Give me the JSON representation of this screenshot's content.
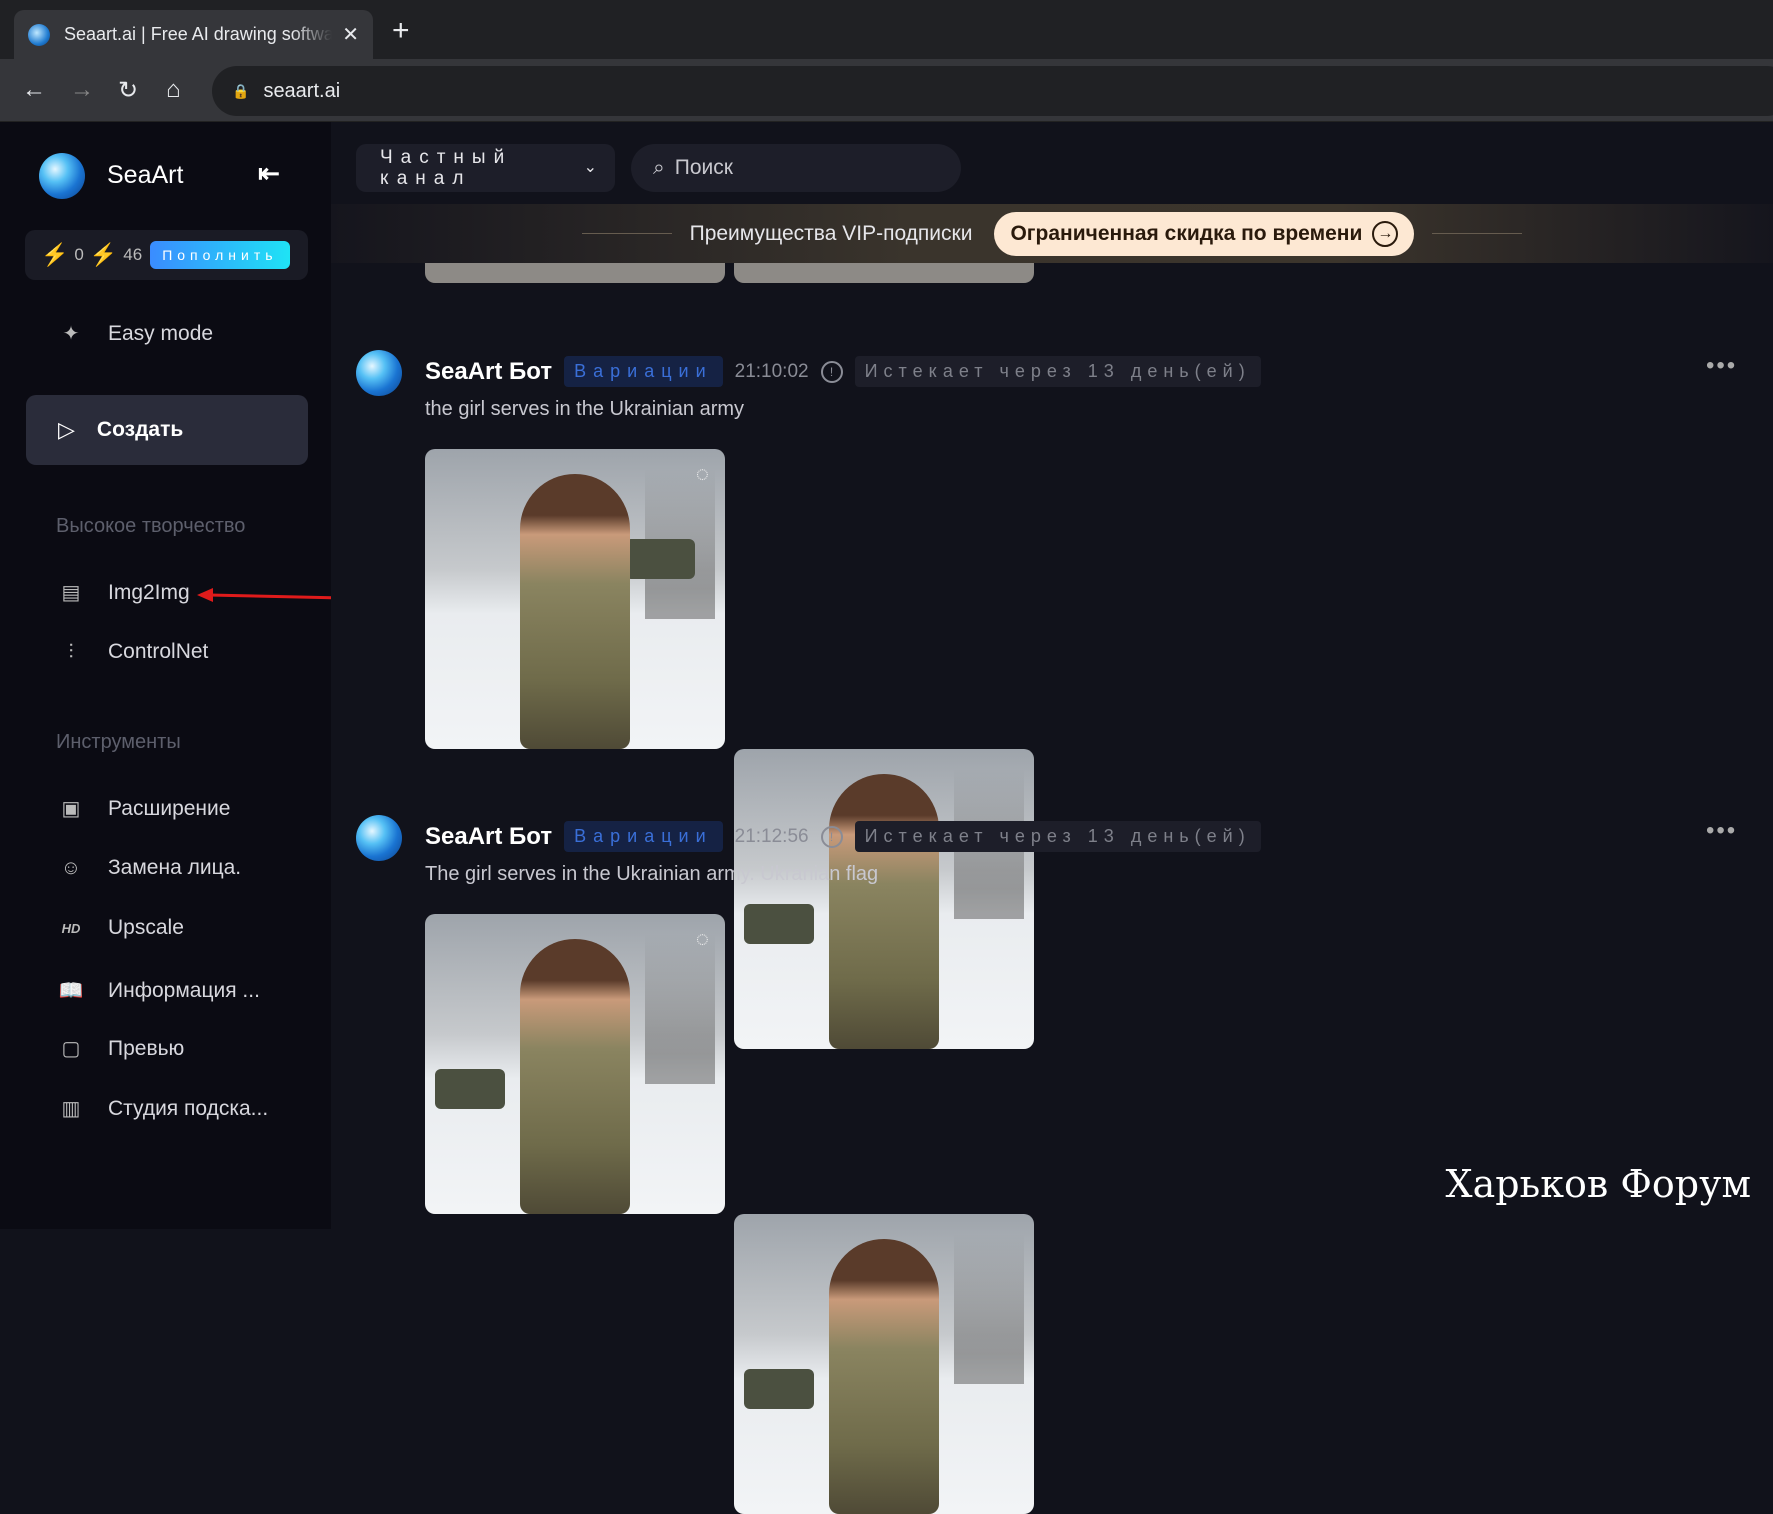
{
  "browser": {
    "tab_title": "Seaart.ai | Free AI drawing software",
    "url": "seaart.ai"
  },
  "sidebar": {
    "brand": "SeaArt",
    "credits": {
      "stamina": "0",
      "energy": "46",
      "topup": "Пополнить"
    },
    "easy_mode": "Easy mode",
    "create": "Создать",
    "section1": "Высокое творчество",
    "section1_items": [
      {
        "label": "Img2Img",
        "icon": "image-icon"
      },
      {
        "label": "ControlNet",
        "icon": "sliders-icon"
      }
    ],
    "section2": "Инструменты",
    "section2_items": [
      {
        "label": "Расширение",
        "icon": "expand-icon"
      },
      {
        "label": "Замена лица.",
        "icon": "face-swap-icon"
      },
      {
        "label": "Upscale",
        "icon": "hd-icon"
      },
      {
        "label": "Информация ...",
        "icon": "book-icon"
      },
      {
        "label": "Превью",
        "icon": "preview-icon"
      },
      {
        "label": "Студия подска...",
        "icon": "studio-icon"
      }
    ]
  },
  "topbar": {
    "channel": "Частный канал",
    "search_placeholder": "Поиск"
  },
  "vip": {
    "text": "Преимущества VIP-подписки",
    "button": "Ограниченная скидка по времени"
  },
  "messages": [
    {
      "author": "SeaArt Бот",
      "badge": "Вариации",
      "time": "21:10:02",
      "expires": "Истекает через 13 день(ей)",
      "prompt": "the girl serves in the Ukrainian army"
    },
    {
      "author": "SeaArt Бот",
      "badge": "Вариации",
      "time": "21:12:56",
      "expires": "Истекает через 13 день(ей)",
      "prompt": "The girl serves in the Ukrainian army. Ukranian flag"
    }
  ],
  "watermark": "Харьков Форум",
  "colors": {
    "accent": "#3a8cff",
    "annotation_arrow": "#e01b1b"
  }
}
